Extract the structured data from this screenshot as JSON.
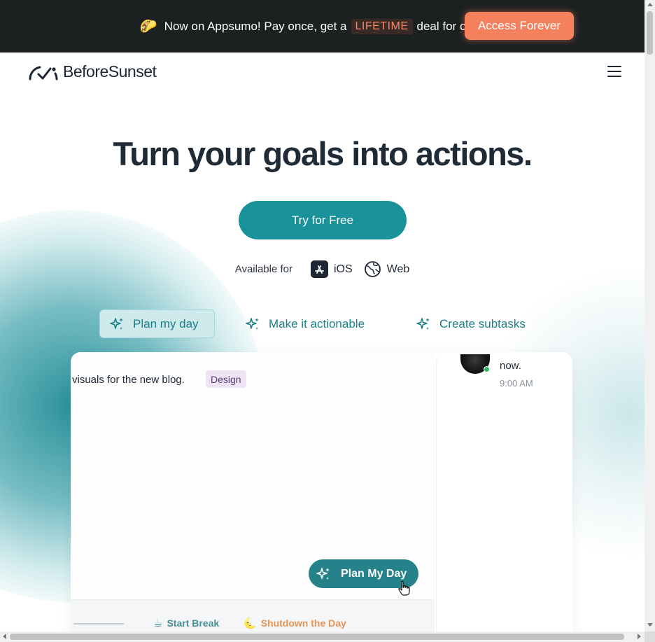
{
  "promo": {
    "emoji": "🌮",
    "text_before": "Now on Appsumo! Pay once, get a",
    "highlight": "LIFETIME",
    "text_after": "deal for only $49",
    "cta_label": "Access Forever"
  },
  "nav": {
    "logo_text": "BeforeSunset",
    "menu_icon": "hamburger-menu-icon"
  },
  "hero": {
    "title": "Turn your goals into actions.",
    "cta_label": "Try for Free",
    "available_label": "Available for",
    "platforms": [
      {
        "label": "iOS",
        "icon": "app-store-icon"
      },
      {
        "label": "Web",
        "icon": "globe-icon"
      }
    ]
  },
  "feature_tabs": [
    {
      "label": "Plan my day",
      "icon": "sparkles-icon",
      "active": true
    },
    {
      "label": "Make it actionable",
      "icon": "sparkles-icon",
      "active": false
    },
    {
      "label": "Create subtasks",
      "icon": "sparkles-icon",
      "active": false
    }
  ],
  "preview": {
    "task_text": "visuals for the new blog.",
    "task_tag": "Design",
    "plan_button_label": "Plan My Day",
    "bottom_bar": {
      "break_label": "Start Break",
      "break_icon": "☕",
      "shutdown_label": "Shutdown the Day",
      "shutdown_icon": "🌜"
    },
    "message": {
      "text": "now.",
      "time": "9:00 AM"
    }
  },
  "colors": {
    "promo_bg": "#1b2020",
    "promo_cta": "#f5805e",
    "primary_teal": "#1a929a",
    "tab_text": "#1a7f88",
    "tag_bg": "#efe4f6"
  }
}
